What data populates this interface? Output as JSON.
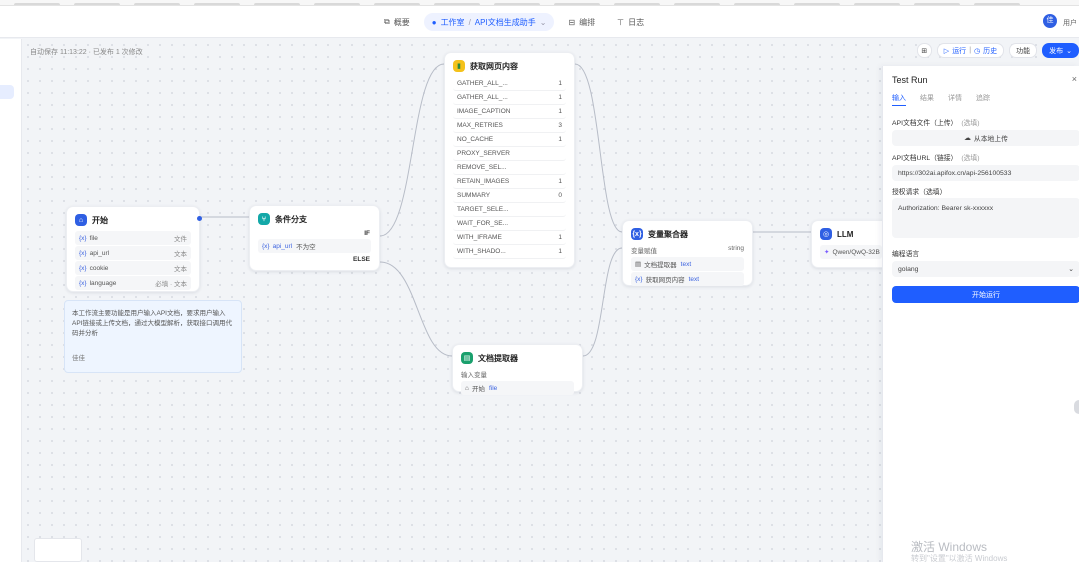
{
  "topbar": {
    "tabs": [
      {
        "label": "概要",
        "icon": "copy-icon"
      },
      {
        "label": "编排",
        "icon": "tool-icon"
      },
      {
        "label": "日志",
        "icon": "log-icon"
      }
    ],
    "breadcrumb": {
      "workspace": "工作室",
      "app": "API文档生成助手"
    },
    "user_initial": "佳",
    "user_name": "用户"
  },
  "canvas": {
    "autosave_text": "自动保存 11:13:22 · 已发布 1 次修改"
  },
  "toolbar": {
    "run_label": "运行",
    "history_label": "历史",
    "feature_label": "功能",
    "publish_label": "发布"
  },
  "nodes": {
    "start": {
      "title": "开始",
      "vars": [
        {
          "name": "file",
          "type": "文件"
        },
        {
          "name": "api_url",
          "type": "文本"
        },
        {
          "name": "cookie",
          "type": "文本"
        },
        {
          "name": "language",
          "type": "必填 · 文本"
        }
      ]
    },
    "branch": {
      "title": "条件分支",
      "if_label": "IF",
      "cond_var": "api_url",
      "cond_op": "不为空",
      "else_label": "ELSE"
    },
    "fetch": {
      "title": "获取网页内容",
      "params": [
        {
          "name": "GATHER_ALL_...",
          "val": "1"
        },
        {
          "name": "GATHER_ALL_...",
          "val": "1"
        },
        {
          "name": "IMAGE_CAPTION",
          "val": "1"
        },
        {
          "name": "MAX_RETRIES",
          "val": "3"
        },
        {
          "name": "NO_CACHE",
          "val": "1"
        },
        {
          "name": "PROXY_SERVER",
          "val": ""
        },
        {
          "name": "REMOVE_SEL...",
          "val": ""
        },
        {
          "name": "RETAIN_IMAGES",
          "val": "1"
        },
        {
          "name": "SUMMARY",
          "val": "0"
        },
        {
          "name": "TARGET_SELE...",
          "val": ""
        },
        {
          "name": "WAIT_FOR_SE...",
          "val": ""
        },
        {
          "name": "WITH_IFRAME",
          "val": "1"
        },
        {
          "name": "WITH_SHADO...",
          "val": "1"
        }
      ]
    },
    "extractor": {
      "title": "文档提取器",
      "input_label": "输入变量",
      "input_src": "开始",
      "input_var": "file"
    },
    "aggregator": {
      "title": "变量聚合器",
      "group_label": "变量赋值",
      "group_type": "string",
      "items": [
        {
          "src": "文档提取器",
          "var": "text"
        },
        {
          "src": "获取网页内容",
          "var": "text"
        }
      ]
    },
    "llm": {
      "title": "LLM",
      "model": "Qwen/QwQ-32B"
    }
  },
  "note": {
    "text": "本工作流主要功能是用户输入API文档，要求用户输入API链接或上传文档，通过大模型解析，获取接口调用代码并分析",
    "author": "佳佳"
  },
  "panel": {
    "title": "Test Run",
    "tabs": [
      "输入",
      "结果",
      "详情",
      "追踪"
    ],
    "file_label": "API文档文件（上传）",
    "file_optional": "(选填)",
    "upload_label": "从本地上传",
    "url_label": "API文档URL（链接）",
    "url_optional": "(选填)",
    "url_value": "https://302ai.apifox.cn/api-256100533",
    "cookie_label": "授权请求（选填）",
    "cookie_value": "Authorization: Bearer sk-xxxxxx",
    "lang_label": "编程语言",
    "lang_value": "golang",
    "start_btn": "开始运行"
  },
  "watermark": {
    "line1": "激活 Windows",
    "line2": "转到\"设置\"以激活 Windows"
  }
}
